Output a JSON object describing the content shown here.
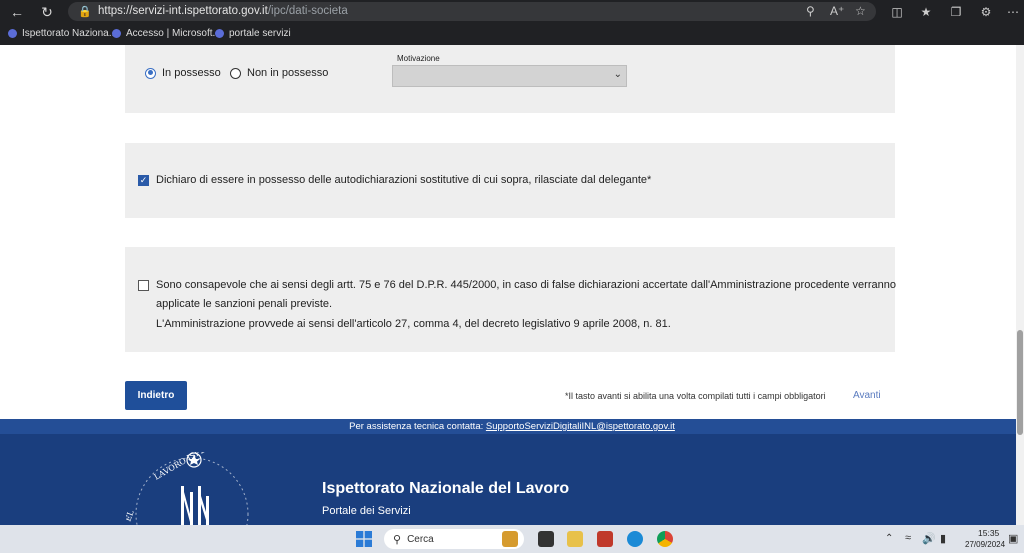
{
  "browser": {
    "url_host": "https://servizi-int.ispettorato.gov.it",
    "url_path": "/ipc/dati-societa",
    "bookmarks": [
      "Ispettorato Naziona...",
      "Accesso | Microsoft...",
      "portale servizi"
    ]
  },
  "section1": {
    "radio_options": [
      {
        "label": "In possesso",
        "selected": true
      },
      {
        "label": "Non in possesso",
        "selected": false
      }
    ],
    "motivazione_label": "Motivazione",
    "motivazione_value": ""
  },
  "section2": {
    "checked": true,
    "label": "Dichiaro di essere in possesso delle autodichiarazioni sostitutive di cui sopra, rilasciate dal delegante*"
  },
  "section3": {
    "checked": false,
    "line1": "Sono consapevole che ai sensi degli artt. 75 e 76 del D.P.R. 445/2000, in caso di false dichiarazioni accertate dall'Amministrazione procedente verranno",
    "line2": "applicate le sanzioni penali previste.",
    "line3": "L'Amministrazione provvede ai sensi dell'articolo 27, comma 4, del decreto legislativo 9 aprile 2008, n. 81."
  },
  "actions": {
    "back_label": "Indietro",
    "note": "*Il tasto avanti si abilita una volta compilati tutti i campi obbligatori",
    "next_label": "Avanti"
  },
  "help": {
    "text": "Per assistenza tecnica contatta:",
    "email": "SupportoServiziDigitaliINL@ispettorato.gov.it"
  },
  "footer": {
    "org_name": "Ispettorato Nazionale del Lavoro",
    "org_sub": "Portale dei Servizi",
    "seal_text": "LAVORO ISPETTOR",
    "seal_left_letter": "EL"
  },
  "taskbar": {
    "search_placeholder": "Cerca",
    "time": "15:35",
    "date": "27/09/2024"
  },
  "colors": {
    "primary": "#1f4f9a",
    "footer": "#1a3e7e",
    "help_bar": "#244e96",
    "panel": "#eeeeee"
  }
}
